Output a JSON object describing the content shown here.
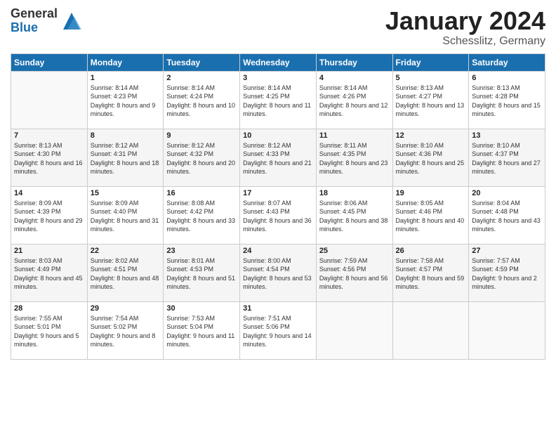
{
  "header": {
    "logo_general": "General",
    "logo_blue": "Blue",
    "title": "January 2024",
    "location": "Schesslitz, Germany"
  },
  "days_of_week": [
    "Sunday",
    "Monday",
    "Tuesday",
    "Wednesday",
    "Thursday",
    "Friday",
    "Saturday"
  ],
  "weeks": [
    [
      {
        "day": "",
        "empty": true
      },
      {
        "day": "1",
        "sunrise": "Sunrise: 8:14 AM",
        "sunset": "Sunset: 4:23 PM",
        "daylight": "Daylight: 8 hours and 9 minutes."
      },
      {
        "day": "2",
        "sunrise": "Sunrise: 8:14 AM",
        "sunset": "Sunset: 4:24 PM",
        "daylight": "Daylight: 8 hours and 10 minutes."
      },
      {
        "day": "3",
        "sunrise": "Sunrise: 8:14 AM",
        "sunset": "Sunset: 4:25 PM",
        "daylight": "Daylight: 8 hours and 11 minutes."
      },
      {
        "day": "4",
        "sunrise": "Sunrise: 8:14 AM",
        "sunset": "Sunset: 4:26 PM",
        "daylight": "Daylight: 8 hours and 12 minutes."
      },
      {
        "day": "5",
        "sunrise": "Sunrise: 8:13 AM",
        "sunset": "Sunset: 4:27 PM",
        "daylight": "Daylight: 8 hours and 13 minutes."
      },
      {
        "day": "6",
        "sunrise": "Sunrise: 8:13 AM",
        "sunset": "Sunset: 4:28 PM",
        "daylight": "Daylight: 8 hours and 15 minutes."
      }
    ],
    [
      {
        "day": "7",
        "sunrise": "Sunrise: 8:13 AM",
        "sunset": "Sunset: 4:30 PM",
        "daylight": "Daylight: 8 hours and 16 minutes."
      },
      {
        "day": "8",
        "sunrise": "Sunrise: 8:12 AM",
        "sunset": "Sunset: 4:31 PM",
        "daylight": "Daylight: 8 hours and 18 minutes."
      },
      {
        "day": "9",
        "sunrise": "Sunrise: 8:12 AM",
        "sunset": "Sunset: 4:32 PM",
        "daylight": "Daylight: 8 hours and 20 minutes."
      },
      {
        "day": "10",
        "sunrise": "Sunrise: 8:12 AM",
        "sunset": "Sunset: 4:33 PM",
        "daylight": "Daylight: 8 hours and 21 minutes."
      },
      {
        "day": "11",
        "sunrise": "Sunrise: 8:11 AM",
        "sunset": "Sunset: 4:35 PM",
        "daylight": "Daylight: 8 hours and 23 minutes."
      },
      {
        "day": "12",
        "sunrise": "Sunrise: 8:10 AM",
        "sunset": "Sunset: 4:36 PM",
        "daylight": "Daylight: 8 hours and 25 minutes."
      },
      {
        "day": "13",
        "sunrise": "Sunrise: 8:10 AM",
        "sunset": "Sunset: 4:37 PM",
        "daylight": "Daylight: 8 hours and 27 minutes."
      }
    ],
    [
      {
        "day": "14",
        "sunrise": "Sunrise: 8:09 AM",
        "sunset": "Sunset: 4:39 PM",
        "daylight": "Daylight: 8 hours and 29 minutes."
      },
      {
        "day": "15",
        "sunrise": "Sunrise: 8:09 AM",
        "sunset": "Sunset: 4:40 PM",
        "daylight": "Daylight: 8 hours and 31 minutes."
      },
      {
        "day": "16",
        "sunrise": "Sunrise: 8:08 AM",
        "sunset": "Sunset: 4:42 PM",
        "daylight": "Daylight: 8 hours and 33 minutes."
      },
      {
        "day": "17",
        "sunrise": "Sunrise: 8:07 AM",
        "sunset": "Sunset: 4:43 PM",
        "daylight": "Daylight: 8 hours and 36 minutes."
      },
      {
        "day": "18",
        "sunrise": "Sunrise: 8:06 AM",
        "sunset": "Sunset: 4:45 PM",
        "daylight": "Daylight: 8 hours and 38 minutes."
      },
      {
        "day": "19",
        "sunrise": "Sunrise: 8:05 AM",
        "sunset": "Sunset: 4:46 PM",
        "daylight": "Daylight: 8 hours and 40 minutes."
      },
      {
        "day": "20",
        "sunrise": "Sunrise: 8:04 AM",
        "sunset": "Sunset: 4:48 PM",
        "daylight": "Daylight: 8 hours and 43 minutes."
      }
    ],
    [
      {
        "day": "21",
        "sunrise": "Sunrise: 8:03 AM",
        "sunset": "Sunset: 4:49 PM",
        "daylight": "Daylight: 8 hours and 45 minutes."
      },
      {
        "day": "22",
        "sunrise": "Sunrise: 8:02 AM",
        "sunset": "Sunset: 4:51 PM",
        "daylight": "Daylight: 8 hours and 48 minutes."
      },
      {
        "day": "23",
        "sunrise": "Sunrise: 8:01 AM",
        "sunset": "Sunset: 4:53 PM",
        "daylight": "Daylight: 8 hours and 51 minutes."
      },
      {
        "day": "24",
        "sunrise": "Sunrise: 8:00 AM",
        "sunset": "Sunset: 4:54 PM",
        "daylight": "Daylight: 8 hours and 53 minutes."
      },
      {
        "day": "25",
        "sunrise": "Sunrise: 7:59 AM",
        "sunset": "Sunset: 4:56 PM",
        "daylight": "Daylight: 8 hours and 56 minutes."
      },
      {
        "day": "26",
        "sunrise": "Sunrise: 7:58 AM",
        "sunset": "Sunset: 4:57 PM",
        "daylight": "Daylight: 8 hours and 59 minutes."
      },
      {
        "day": "27",
        "sunrise": "Sunrise: 7:57 AM",
        "sunset": "Sunset: 4:59 PM",
        "daylight": "Daylight: 9 hours and 2 minutes."
      }
    ],
    [
      {
        "day": "28",
        "sunrise": "Sunrise: 7:55 AM",
        "sunset": "Sunset: 5:01 PM",
        "daylight": "Daylight: 9 hours and 5 minutes."
      },
      {
        "day": "29",
        "sunrise": "Sunrise: 7:54 AM",
        "sunset": "Sunset: 5:02 PM",
        "daylight": "Daylight: 9 hours and 8 minutes."
      },
      {
        "day": "30",
        "sunrise": "Sunrise: 7:53 AM",
        "sunset": "Sunset: 5:04 PM",
        "daylight": "Daylight: 9 hours and 11 minutes."
      },
      {
        "day": "31",
        "sunrise": "Sunrise: 7:51 AM",
        "sunset": "Sunset: 5:06 PM",
        "daylight": "Daylight: 9 hours and 14 minutes."
      },
      {
        "day": "",
        "empty": true
      },
      {
        "day": "",
        "empty": true
      },
      {
        "day": "",
        "empty": true
      }
    ]
  ]
}
